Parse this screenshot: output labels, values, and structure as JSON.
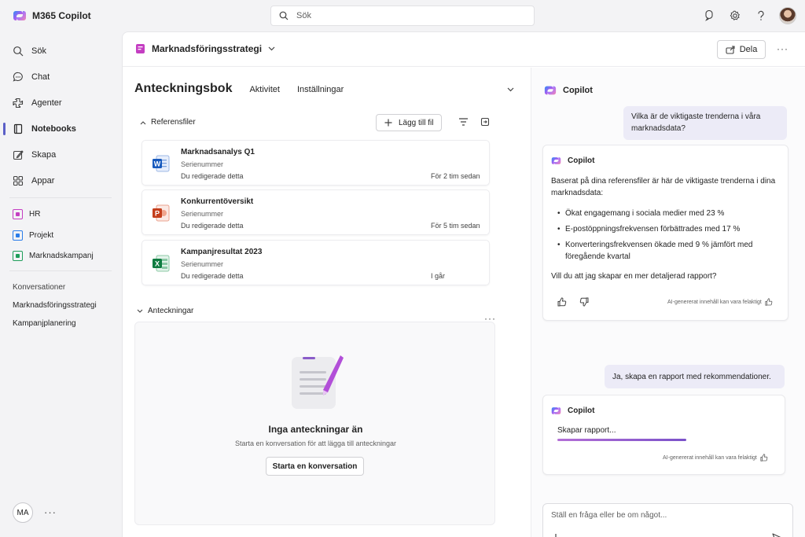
{
  "app": {
    "title": "M365 Copilot"
  },
  "search": {
    "placeholder": "Sök"
  },
  "topbar_icons": [
    "copilot-chat-icon",
    "gear-icon",
    "help-icon",
    "avatar"
  ],
  "nav": {
    "items": [
      {
        "label": "Sök",
        "icon": "search-icon"
      },
      {
        "label": "Chat",
        "icon": "chat-icon"
      },
      {
        "label": "Agenter",
        "icon": "agents-icon"
      },
      {
        "label": "Notebooks",
        "icon": "notebook-icon",
        "active": true
      },
      {
        "label": "Skapa",
        "icon": "create-icon"
      },
      {
        "label": "Appar",
        "icon": "apps-icon"
      }
    ],
    "notebooks": [
      {
        "label": "HR",
        "color": "#c43ec2"
      },
      {
        "label": "Projekt",
        "color": "#2b7de9"
      },
      {
        "label": "Marknadskampanj",
        "color": "#1f9e5a"
      }
    ],
    "conversations_title": "Konversationer",
    "conversations": [
      "Marknadsföringsstrategi",
      "Kampanjplanering"
    ],
    "user_initials": "MA",
    "more": "···"
  },
  "header": {
    "notebook_title": "Marknadsföringsstrategi",
    "share_label": "Dela",
    "more": "···"
  },
  "notebook": {
    "title": "Anteckningsbok",
    "tabs": [
      "Aktivitet",
      "Inställningar"
    ],
    "references_label": "Referensfiler",
    "add_file_label": "Lägg till fil",
    "files": [
      {
        "name": "Marknadsanalys Q1",
        "sub": "Serienummer",
        "edit": "Du redigerade detta",
        "time": "För 2 tim sedan",
        "type": "word"
      },
      {
        "name": "Konkurrentöversikt",
        "sub": "Serienummer",
        "edit": "Du redigerade detta",
        "time": "För 5 tim sedan",
        "type": "powerpoint"
      },
      {
        "name": "Kampanjresultat 2023",
        "sub": "Serienummer",
        "edit": "Du redigerade detta",
        "time": "I går",
        "type": "excel"
      }
    ],
    "notes_label": "Anteckningar",
    "notes_more": "···",
    "empty_title": "Inga anteckningar än",
    "empty_sub": "Starta en konversation för att lägga till anteckningar",
    "start_button": "Starta en konversation"
  },
  "copilot": {
    "title": "Copilot",
    "user_message_1": "Vilka är de viktigaste trenderna i våra marknadsdata?",
    "response_1": {
      "author": "Copilot",
      "intro": "Baserat på dina referensfiler är här de viktigaste trenderna i dina marknadsdata:",
      "bullets": [
        "Ökat engagemang i sociala medier med 23 %",
        "E-postöppningsfrekvensen förbättrades med 17 %",
        "Konverteringsfrekvensen ökade med 9 % jämfört med föregående kvartal"
      ],
      "question": "Vill du att jag skapar en mer detaljerad rapport?",
      "disclaimer": "AI-genererat innehåll kan vara felaktigt"
    },
    "user_message_2": "Ja, skapa en rapport med rekommendationer.",
    "response_2": {
      "author": "Copilot",
      "status": "Skapar rapport...",
      "disclaimer": "AI-genererat innehåll kan vara felaktigt"
    },
    "input_placeholder": "Ställ en fråga eller be om något..."
  }
}
